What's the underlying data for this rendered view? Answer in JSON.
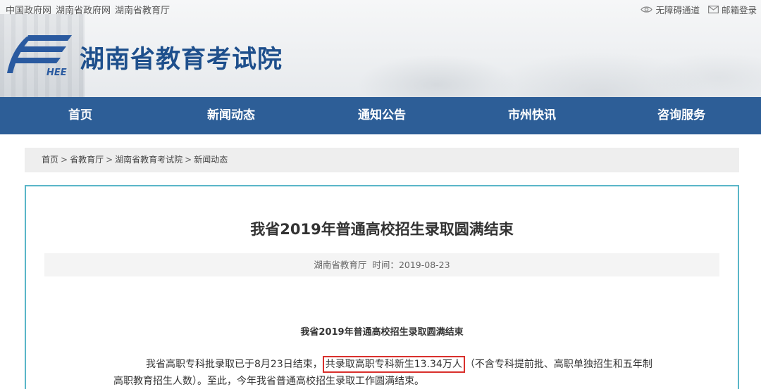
{
  "top_links": [
    "中国政府网",
    "湖南省政府网",
    "湖南省教育厅"
  ],
  "right_links": {
    "accessibility": "无障碍通道",
    "mail_login": "邮箱登录"
  },
  "logo_text": "HEE",
  "site_title": "湖南省教育考试院",
  "nav": [
    "首页",
    "新闻动态",
    "通知公告",
    "市州快讯",
    "咨询服务"
  ],
  "breadcrumb": [
    "首页",
    "省教育厅",
    "湖南省教育考试院",
    "新闻动态"
  ],
  "breadcrumb_sep": ">",
  "article": {
    "title": "我省2019年普通高校招生录取圆满结束",
    "source": "湖南省教育厅",
    "time_label": "时间：",
    "date": "2019-08-23",
    "subtitle": "我省2019年普通高校招生录取圆满结束",
    "para1_start": "我省高职专科批录取已于8月23日结束，",
    "para1_highlight": "共录取高职专科新生13.34万人",
    "para1_end": "（不含专科提前批、高职单独招生和五年制",
    "para2": "高职教育招生人数）。至此，今年我省普通高校招生录取工作圆满结束。"
  },
  "colors": {
    "nav_bg": "#2d5e97",
    "title_blue": "#1e4f8c",
    "panel_border": "#5ab6c8",
    "highlight_border": "#d9302c"
  },
  "icons": {
    "accessibility": "eye-icon",
    "mail": "mail-icon"
  }
}
